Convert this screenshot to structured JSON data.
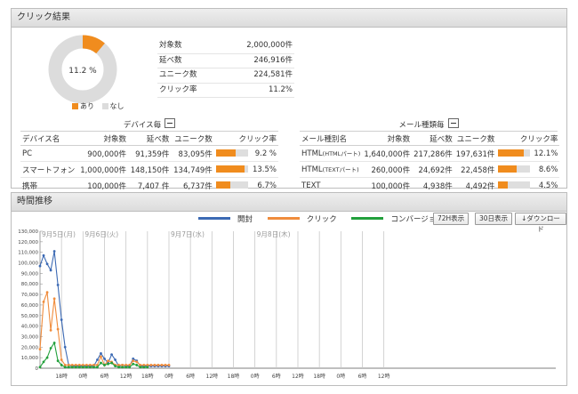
{
  "panel1": {
    "title": "クリック結果",
    "pie": {
      "center_label": "11.2 %",
      "click_fraction": 0.112,
      "colors": {
        "click": "#f08c1e",
        "rest": "#dcdcdc"
      }
    },
    "legend": {
      "click": "あり",
      "rest": "なし"
    },
    "summary": [
      {
        "label": "対象数",
        "value": "2,000,000件"
      },
      {
        "label": "延べ数",
        "value": "246,916件"
      },
      {
        "label": "ユニーク数",
        "value": "224,581件"
      },
      {
        "label": "クリック率",
        "value": "11.2%"
      }
    ],
    "device": {
      "title": "デバイス毎",
      "headers": [
        "デバイス名",
        "対象数",
        "延べ数",
        "ユニーク数",
        "クリック率"
      ],
      "rows": [
        {
          "name": "PC",
          "target": "900,000件",
          "total": "91,359件",
          "unique": "83,095件",
          "rate": "9.2 %",
          "rate_value": 0.092
        },
        {
          "name": "スマートフォン",
          "target": "1,000,000件",
          "total": "148,150件",
          "unique": "134,749件",
          "rate": "13.5%",
          "rate_value": 0.135
        },
        {
          "name": "携帯",
          "target": "100,000件",
          "total": "7,407 件",
          "unique": "6,737件",
          "rate": "6.7%",
          "rate_value": 0.067
        }
      ]
    },
    "mail": {
      "title": "メール種類毎",
      "headers": [
        "メール種別名",
        "対象数",
        "延べ数",
        "ユニーク数",
        "クリック率"
      ],
      "rows": [
        {
          "name": "HTML",
          "name_sub": "(HTMLパート)",
          "target": "1,640,000件",
          "total": "217,286件",
          "unique": "197,631件",
          "rate": "12.1%",
          "rate_value": 0.121
        },
        {
          "name": "HTML",
          "name_sub": "(TEXTパート)",
          "target": "260,000件",
          "total": "24,692件",
          "unique": "22,458件",
          "rate": "8.6%",
          "rate_value": 0.086
        },
        {
          "name": "TEXT",
          "name_sub": "",
          "target": "100,000件",
          "total": "4,938件",
          "unique": "4,492件",
          "rate": "4.5%",
          "rate_value": 0.045
        }
      ]
    }
  },
  "panel2": {
    "title": "時間推移",
    "buttons": {
      "h72": "72H表示",
      "d30": "30日表示",
      "download": "↓ダウンロード"
    }
  },
  "chart_data": {
    "type": "line",
    "ylim": [
      0,
      130000
    ],
    "y_ticks": [
      "130,000",
      "120,000",
      "110,000",
      "100,000",
      "90,000",
      "80,000",
      "70,000",
      "60,000",
      "50,000",
      "40,000",
      "30,000",
      "20,000",
      "10,000",
      "0"
    ],
    "x_hours": [
      0,
      144
    ],
    "x_ticks": [
      {
        "h": 6,
        "label": "18時"
      },
      {
        "h": 12,
        "label": "0時"
      },
      {
        "h": 18,
        "label": "6時"
      },
      {
        "h": 24,
        "label": "12時"
      },
      {
        "h": 30,
        "label": "18時"
      },
      {
        "h": 36,
        "label": "0時"
      },
      {
        "h": 42,
        "label": "6時"
      },
      {
        "h": 48,
        "label": "12時"
      },
      {
        "h": 54,
        "label": "18時"
      },
      {
        "h": 60,
        "label": "0時"
      },
      {
        "h": 66,
        "label": "6時"
      },
      {
        "h": 72,
        "label": "12時"
      },
      {
        "h": 78,
        "label": "18時"
      },
      {
        "h": 84,
        "label": "0時"
      },
      {
        "h": 90,
        "label": "6時"
      },
      {
        "h": 96,
        "label": "12時"
      }
    ],
    "day_markers": [
      {
        "h": 0,
        "label": "9月5日(月)"
      },
      {
        "h": 12,
        "label": "9月6日(火)"
      },
      {
        "h": 36,
        "label": "9月7日(水)"
      },
      {
        "h": 60,
        "label": "9月8日(木)"
      }
    ],
    "series": [
      {
        "name": "開封",
        "color": "#3c6ab4",
        "x": [
          0,
          1,
          2,
          3,
          4,
          5,
          6,
          7,
          8,
          9,
          10,
          11,
          12,
          13,
          14,
          15,
          16,
          17,
          18,
          19,
          20,
          21,
          22,
          23,
          24,
          25,
          26,
          27,
          28,
          29,
          30,
          31,
          32,
          33,
          34,
          35,
          36
        ],
        "y": [
          97000,
          107000,
          99000,
          93000,
          111000,
          79000,
          46000,
          20000,
          3000,
          2000,
          2000,
          2000,
          2000,
          2000,
          2000,
          2000,
          8000,
          14000,
          9000,
          5000,
          13000,
          8000,
          2000,
          3000,
          2000,
          2000,
          9000,
          7000,
          2000,
          2000,
          2000,
          2000,
          2000,
          2000,
          2000,
          2000,
          2000
        ]
      },
      {
        "name": "クリック",
        "color": "#f08c3c",
        "x": [
          0,
          1,
          2,
          3,
          4,
          5,
          6,
          7,
          8,
          9,
          10,
          11,
          12,
          13,
          14,
          15,
          16,
          17,
          18,
          19,
          20,
          21,
          22,
          23,
          24,
          25,
          26,
          27,
          28,
          29,
          30,
          31,
          32,
          33,
          34,
          35,
          36
        ],
        "y": [
          18000,
          63000,
          72000,
          36000,
          66000,
          37000,
          8000,
          3000,
          3000,
          3000,
          3000,
          3000,
          3000,
          3000,
          3000,
          3000,
          3000,
          11000,
          3000,
          7000,
          6000,
          3000,
          3000,
          3000,
          3000,
          3000,
          7000,
          6000,
          3000,
          3000,
          3000,
          3000,
          3000,
          3000,
          3000,
          3000,
          3000
        ]
      },
      {
        "name": "コンバージョン",
        "color": "#22a03c",
        "x": [
          0,
          1,
          2,
          3,
          4,
          5,
          6,
          7,
          8,
          9,
          10,
          11,
          12,
          13,
          14,
          15,
          16,
          17,
          18,
          19,
          20,
          21,
          22,
          23,
          24,
          25,
          26,
          27,
          28,
          29,
          30
        ],
        "y": [
          1000,
          6000,
          10000,
          19000,
          24000,
          7000,
          3000,
          1000,
          1000,
          1000,
          1000,
          1000,
          1000,
          1000,
          1000,
          1000,
          1000,
          5000,
          3000,
          4000,
          5000,
          2000,
          1000,
          1000,
          1000,
          1000,
          4000,
          3000,
          1000,
          1000,
          1000
        ]
      }
    ]
  }
}
